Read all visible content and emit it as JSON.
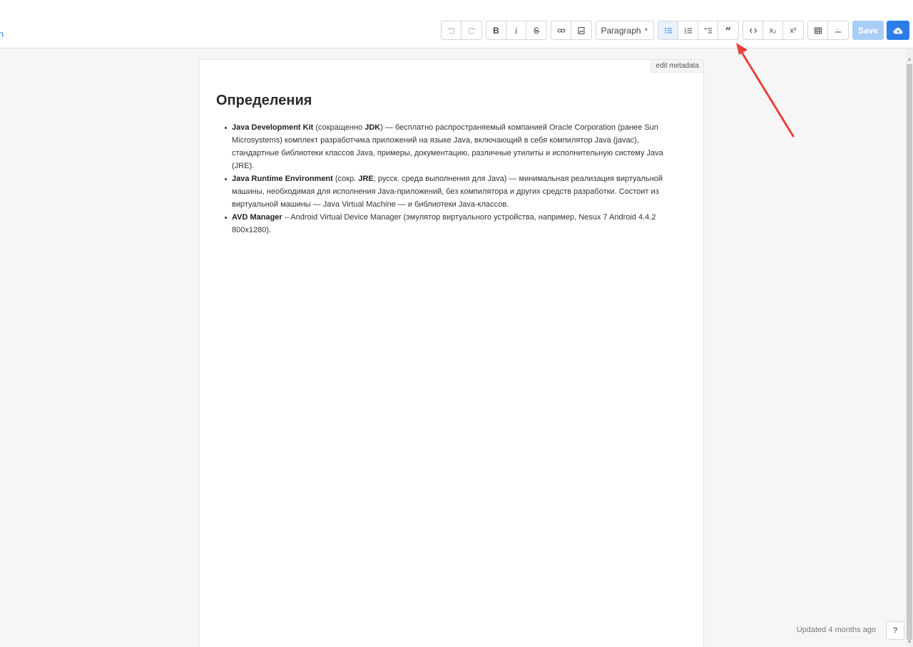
{
  "window": {
    "controls": [
      {
        "name": "minimize-icon",
        "glyph": "—"
      },
      {
        "name": "restore-icon",
        "glyph": "❐"
      },
      {
        "name": "close-icon",
        "glyph": "✕"
      }
    ]
  },
  "header": {
    "back_link_fragment": "n"
  },
  "toolbar": {
    "paragraph_label": "Paragraph",
    "bold_label": "B",
    "italic_label": "i",
    "strike_label": "S",
    "subscript_label": "x₂",
    "superscript_label": "x²",
    "save_label": "Save",
    "icons": {
      "undo": "undo-icon",
      "redo": "redo-icon",
      "link": "link-icon",
      "image": "image-icon",
      "bullet_list": "bullet-list-icon",
      "ordered_list": "ordered-list-icon",
      "task_list": "task-list-icon",
      "blockquote": "blockquote-icon",
      "code": "code-icon",
      "table": "table-icon",
      "horizontal_rule": "horizontal-rule-icon",
      "cloud_upload": "cloud-upload-icon"
    },
    "active_tool": "bullet_list"
  },
  "document": {
    "edit_metadata_label": "edit metadata",
    "title": "Определения",
    "items": [
      {
        "parts": [
          {
            "bold": true,
            "text": "Java Development Kit"
          },
          {
            "bold": false,
            "text": " (сокращенно "
          },
          {
            "bold": true,
            "text": "JDK"
          },
          {
            "bold": false,
            "text": ") — бесплатно распространяемый компанией Oracle Corporation (ранее Sun Microsystems) комплект разработчика приложений на языке Java, включающий в себя компилятор Java (javac), стандартные библиотеки классов Java, примеры, документацию, различные утилиты и исполнительную систему Java (JRE)."
          }
        ]
      },
      {
        "parts": [
          {
            "bold": true,
            "text": "Java Runtime Environment"
          },
          {
            "bold": false,
            "text": " (сокр. "
          },
          {
            "bold": true,
            "text": "JRE"
          },
          {
            "bold": false,
            "text": "; русск. среда выполнения для Java) — минимальная реализация виртуальной машины, необходимая для исполнения Java-приложений, без компилятора и других средств разработки. Состоит из виртуальной машины — Java Virtual Machine — и библиотеки Java-классов."
          }
        ]
      },
      {
        "parts": [
          {
            "bold": true,
            "text": "AVD Manager"
          },
          {
            "bold": false,
            "text": " – Android Virtual Device Manager (эмулятор виртуального устройства, например, Nesux 7 Android 4.4.2 800x1280)."
          }
        ]
      }
    ]
  },
  "footer": {
    "updated_text": "Updated 4 months ago",
    "help_label": "?"
  },
  "colors": {
    "accent": "#2b7de9",
    "save_disabled": "#a8cdf6",
    "annotation_arrow": "#e8413a"
  }
}
